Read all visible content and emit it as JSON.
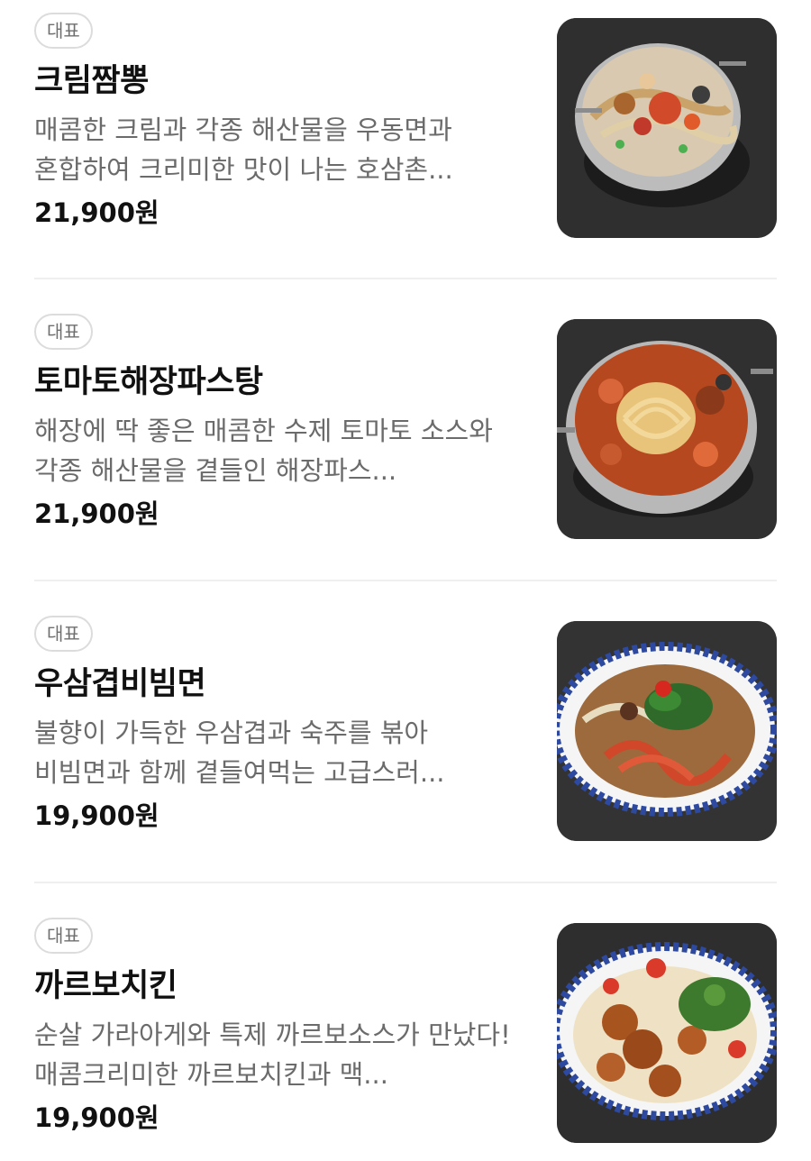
{
  "menu": {
    "items": [
      {
        "badge": "대표",
        "name": "크림짬뽕",
        "description": "매콤한 크림과 각종 해산물을 우동면과 혼합하여 크리미한 맛이 나는 호삼촌...",
        "price": "21,900원",
        "photo": "cream-jjamppong-photo"
      },
      {
        "badge": "대표",
        "name": "토마토해장파스탕",
        "description": "해장에 딱 좋은 매콤한 수제 토마토 소스와 각종 해산물을 곁들인 해장파스...",
        "price": "21,900원",
        "photo": "tomato-pasta-stew-photo"
      },
      {
        "badge": "대표",
        "name": "우삼겹비빔면",
        "description": "불향이 가득한 우삼겹과 숙주를 볶아 비빔면과 함께 곁들여먹는 고급스러...",
        "price": "19,900원",
        "photo": "beef-bibim-noodle-photo"
      },
      {
        "badge": "대표",
        "name": "까르보치킨",
        "description": "순살 가라아게와 특제 까르보소스가 만났다! 매콤크리미한 까르보치킨과 맥...",
        "price": "19,900원",
        "photo": "carbo-chicken-photo"
      }
    ]
  }
}
